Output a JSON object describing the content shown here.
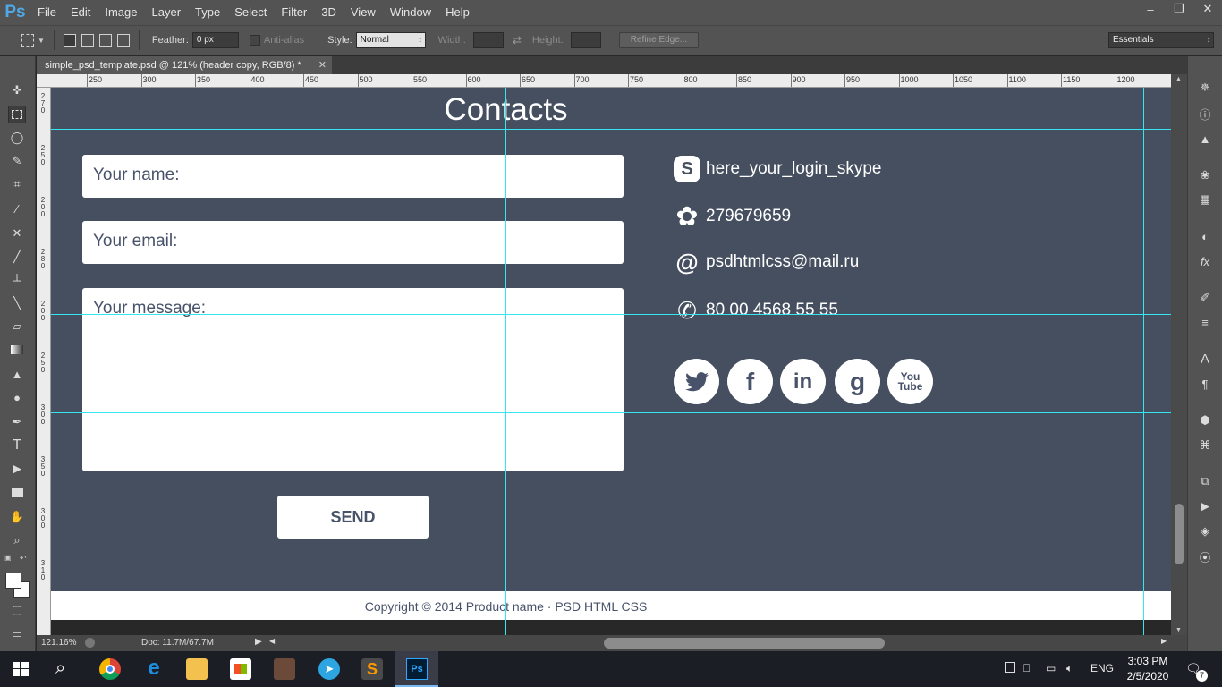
{
  "app": {
    "logo": "Ps",
    "menu": [
      "File",
      "Edit",
      "Image",
      "Layer",
      "Type",
      "Select",
      "Filter",
      "3D",
      "View",
      "Window",
      "Help"
    ],
    "window_controls": [
      "minimize",
      "restore",
      "close"
    ]
  },
  "options_bar": {
    "feather_label": "Feather:",
    "feather_value": "0 px",
    "antialias_label": "Anti-alias",
    "style_label": "Style:",
    "style_value": "Normal",
    "width_label": "Width:",
    "height_label": "Height:",
    "refine_edge": "Refine Edge...",
    "workspace": "Essentials"
  },
  "document": {
    "tab_title": "simple_psd_template.psd @ 121% (header copy, RGB/8) *",
    "zoom": "121.16%",
    "doc_size": "Doc: 11.7M/67.7M"
  },
  "ruler": {
    "h_labels": [
      "250",
      "300",
      "350",
      "400",
      "450",
      "500",
      "550",
      "600",
      "650",
      "700",
      "750",
      "800",
      "850",
      "900",
      "950",
      "1000",
      "1050",
      "1100",
      "1150",
      "1200"
    ],
    "v_labels": [
      "270",
      "250",
      "200",
      "280",
      "200",
      "250",
      "300",
      "350",
      "300",
      "310"
    ]
  },
  "page": {
    "title": "Contacts",
    "name_placeholder": "Your name:",
    "email_placeholder": "Your email:",
    "message_placeholder": "Your message:",
    "send_label": "SEND",
    "skype": "here_your_login_skype",
    "icq": "279679659",
    "email": "psdhtmlcss@mail.ru",
    "phone": "80 00 4568 55 55",
    "social": [
      "twitter",
      "facebook",
      "linkedin",
      "google",
      "youtube"
    ],
    "youtube_label_1": "You",
    "youtube_label_2": "Tube",
    "footer": "Copyright © 2014 Product name · PSD HTML CSS"
  },
  "taskbar": {
    "apps": [
      "start",
      "search",
      "chrome",
      "edge",
      "file-explorer",
      "store",
      "app-dark",
      "telegram",
      "sublime-text",
      "photoshop"
    ],
    "language": "ENG",
    "time": "3:03 PM",
    "date": "2/5/2020",
    "notifications": "7"
  },
  "colors": {
    "ps_ui": "#535353",
    "canvas_bg": "#454f5f",
    "guide": "#35e5f0",
    "ps_blue": "#4fa9e8",
    "text_dark": "#48526a"
  }
}
